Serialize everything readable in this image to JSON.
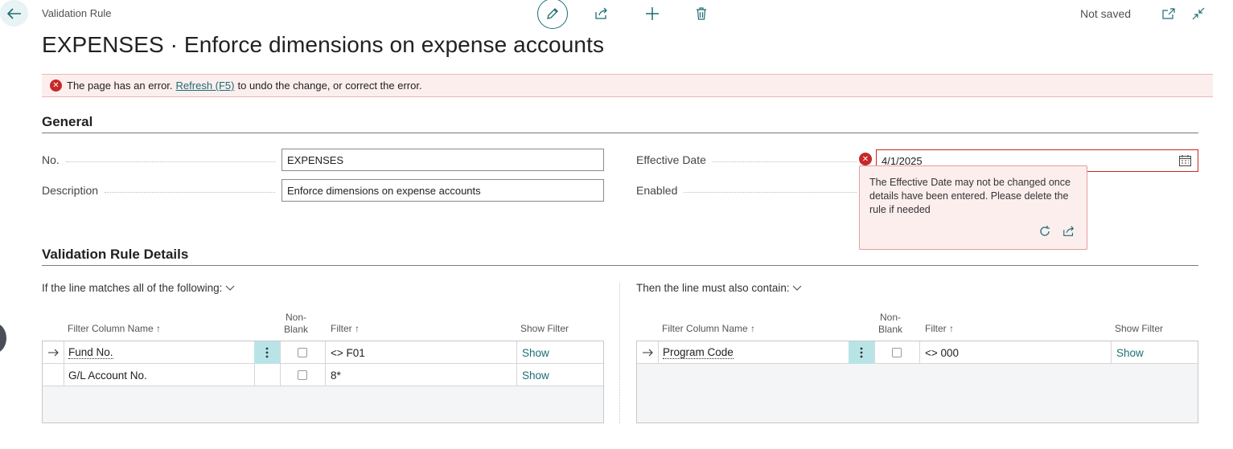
{
  "header": {
    "caption": "Validation Rule",
    "title": "EXPENSES · Enforce dimensions on expense accounts",
    "status": "Not saved"
  },
  "error_bar": {
    "prefix": "The page has an error.",
    "link": "Refresh (F5)",
    "suffix": "to undo the change, or correct the error."
  },
  "general": {
    "title": "General",
    "no_label": "No.",
    "no_value": "EXPENSES",
    "description_label": "Description",
    "description_value": "Enforce dimensions on expense accounts",
    "effective_date_label": "Effective Date",
    "effective_date_value": "4/1/2025",
    "enabled_label": "Enabled"
  },
  "tooltip": {
    "message": "The Effective Date may not be changed once details have been entered. Please delete the rule if needed"
  },
  "details": {
    "title": "Validation Rule Details",
    "left_caption": "If the line matches all of the following:",
    "right_caption": "Then the line must also contain:",
    "columns": {
      "filter_column_name": "Filter Column Name",
      "non_blank_1": "Non-",
      "non_blank_2": "Blank",
      "filter": "Filter",
      "show_filter": "Show Filter"
    },
    "left_rows": [
      {
        "name": "Fund No.",
        "filter": "<> F01",
        "show": "Show"
      },
      {
        "name": "G/L Account No.",
        "filter": "8*",
        "show": "Show"
      }
    ],
    "right_rows": [
      {
        "name": "Program Code",
        "filter": "<> 000",
        "show": "Show"
      }
    ]
  },
  "icons": [
    "back-arrow-icon",
    "edit-pencil-icon",
    "share-icon",
    "plus-icon",
    "trash-icon",
    "open-new-window-icon",
    "collapse-icon",
    "error-icon",
    "calendar-icon",
    "refresh-icon",
    "share-icon",
    "row-arrow-icon",
    "kebab-menu-icon",
    "chevron-down-icon",
    "sort-up-arrow-icon"
  ],
  "colors": {
    "accent": "#1b6e74",
    "error": "#c62828",
    "error_bg": "#fdeeee",
    "selection": "#b9e4e7"
  }
}
